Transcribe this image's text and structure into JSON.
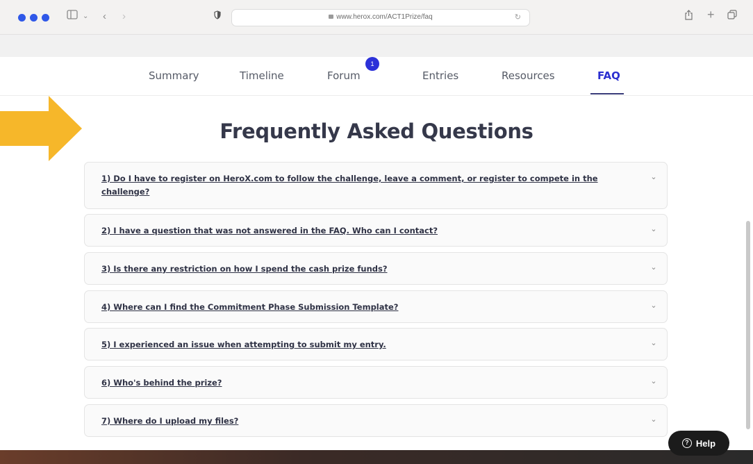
{
  "browser": {
    "url": "www.herox.com/ACT1Prize/faq"
  },
  "nav": {
    "tabs": [
      {
        "label": "Summary"
      },
      {
        "label": "Timeline"
      },
      {
        "label": "Forum",
        "badge": "1"
      },
      {
        "label": "Entries"
      },
      {
        "label": "Resources"
      },
      {
        "label": "FAQ",
        "active": true
      }
    ]
  },
  "page": {
    "title": "Frequently Asked Questions"
  },
  "faq": [
    {
      "question": "1) Do I have to register on HeroX.com to follow the challenge, leave a comment, or register to compete in the challenge?"
    },
    {
      "question": "2) I have a question that was not answered in the FAQ. Who can I contact?"
    },
    {
      "question": "3) Is there any restriction on how I spend the cash prize funds?"
    },
    {
      "question": "4) Where can I find the Commitment Phase Submission Template?"
    },
    {
      "question": "5) I experienced an issue when attempting to submit my entry."
    },
    {
      "question": "6) Who's behind the prize?"
    },
    {
      "question": "7) Where do I upload my files?"
    }
  ],
  "help": {
    "label": "Help"
  },
  "colors": {
    "accent": "#2b2fd0",
    "arrow": "#f6b72a",
    "badge": "#2c31d8"
  }
}
